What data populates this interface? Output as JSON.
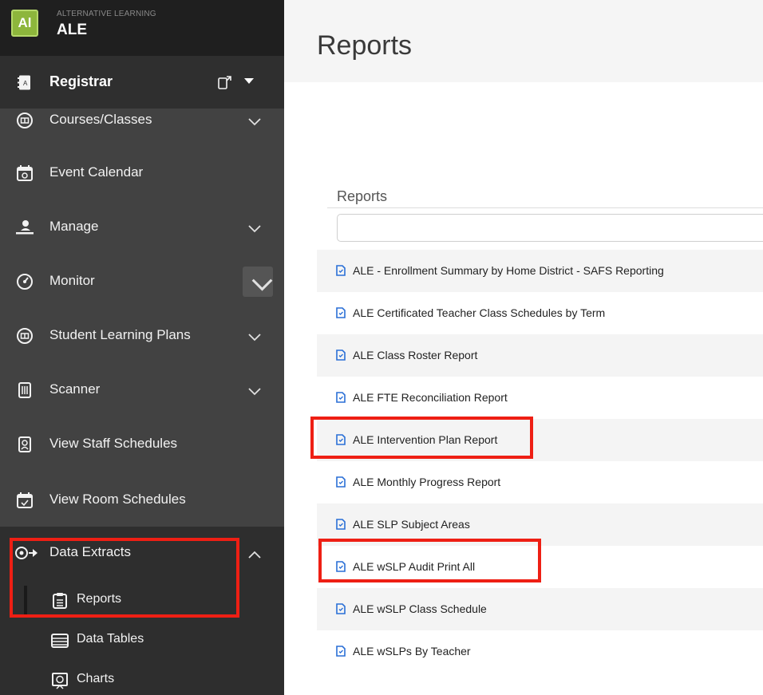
{
  "brand": {
    "logo_text": "Al",
    "subtitle": "ALTERNATIVE LEARNING",
    "title": "ALE"
  },
  "module": {
    "label": "Registrar"
  },
  "nav": {
    "courses": "Courses/Classes",
    "event_calendar": "Event Calendar",
    "manage": "Manage",
    "monitor": "Monitor",
    "slp": "Student Learning Plans",
    "scanner": "Scanner",
    "staff_schedules": "View Staff Schedules",
    "room_schedules": "View Room Schedules",
    "data_extracts": "Data Extracts",
    "sub": {
      "reports": "Reports",
      "data_tables": "Data Tables",
      "charts": "Charts"
    }
  },
  "page": {
    "title": "Reports"
  },
  "panel": {
    "title": "Reports",
    "filter_value": "",
    "filter_placeholder": ""
  },
  "reports": [
    "ALE - Enrollment Summary by Home District - SAFS Reporting",
    "ALE Certificated Teacher Class Schedules by Term",
    "ALE Class Roster Report",
    "ALE FTE Reconciliation Report",
    "ALE Intervention Plan Report",
    "ALE Monthly Progress Report",
    "ALE SLP Subject Areas",
    "ALE wSLP Audit Print All",
    "ALE wSLP Class Schedule",
    "ALE wSLPs By Teacher"
  ],
  "colors": {
    "sidebar_bg": "#424242",
    "brand_bg": "#1f1f1f",
    "logo_green": "#8db63c",
    "highlight_red": "#ee1f14",
    "report_icon_blue": "#2a6fd6"
  }
}
